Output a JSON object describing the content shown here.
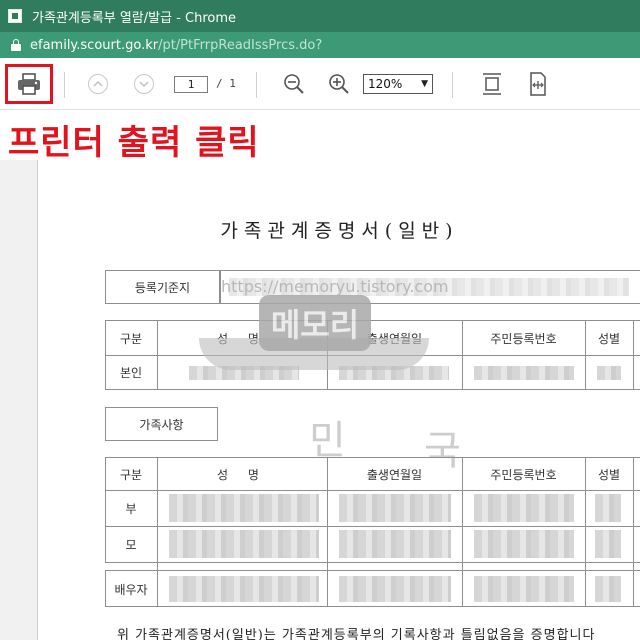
{
  "window": {
    "title": "가족관계등록부 열람/발급 - Chrome"
  },
  "address": {
    "host": "efamily.scourt.go.kr",
    "path": "/pt/PtFrrpReadIssPrcs.do?"
  },
  "toolbar": {
    "page_current": "1",
    "page_total": "/ 1",
    "zoom": "120%"
  },
  "annotation": {
    "text": "프린터 출력 클릭"
  },
  "document": {
    "title": "가족관계증명서(일반)",
    "registry_label": "등록기준지",
    "watermark_url": "https://memoryu.tistory.com",
    "watermark_logo": "메모리",
    "seal_chars": [
      "민",
      "국"
    ],
    "self_table": {
      "headers": [
        "구분",
        "성 명",
        "출생연월일",
        "주민등록번호",
        "성별"
      ],
      "rows": [
        [
          "본인"
        ]
      ]
    },
    "family_label": "가족사항",
    "family_table": {
      "headers": [
        "구분",
        "성 명",
        "출생연월일",
        "주민등록번호",
        "성별"
      ],
      "rows": [
        [
          "부"
        ],
        [
          "모"
        ],
        [
          "배우자"
        ]
      ]
    },
    "footer": "위 가족관계증명서(일반)는 가족관계등록부의 기록사항과 틀림없음을 증명합니다"
  },
  "colors": {
    "titlebar": "#2f7d5e",
    "addressbar": "#3d9a76",
    "annotation": "#e3131e"
  },
  "icons": [
    "app-icon",
    "lock-icon",
    "print-icon",
    "page-up-icon",
    "page-down-icon",
    "zoom-out-icon",
    "zoom-in-icon",
    "fit-page-icon",
    "fit-width-icon"
  ]
}
